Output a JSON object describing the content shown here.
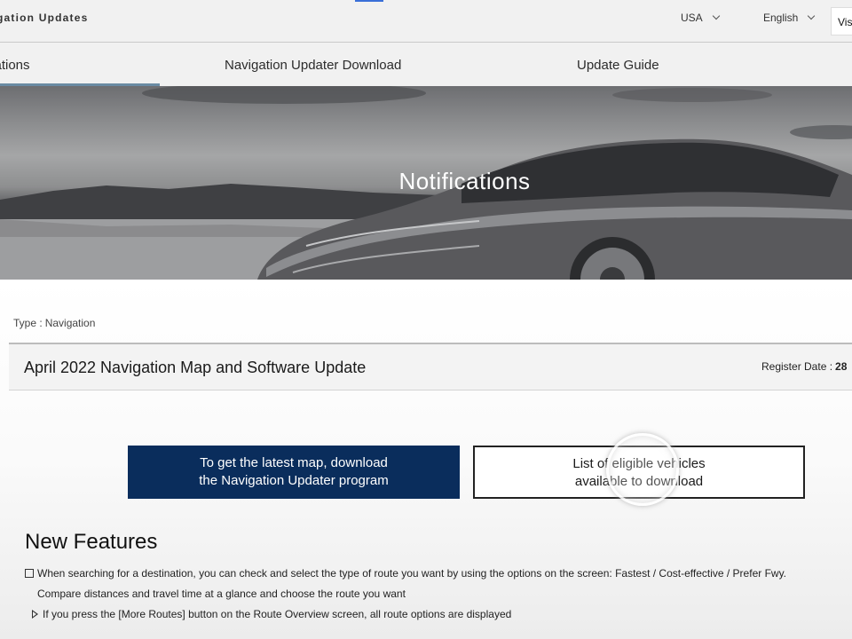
{
  "header": {
    "site_title": "gation Updates",
    "country": "USA",
    "language": "English",
    "visit_label": "Vis"
  },
  "tabs": [
    {
      "label": "cations",
      "active": true
    },
    {
      "label": "Navigation Updater Download",
      "active": false
    },
    {
      "label": "Update Guide",
      "active": false
    }
  ],
  "hero": {
    "title": "Notifications"
  },
  "post": {
    "type_label": "Type :",
    "type_value": "Navigation",
    "title": "April 2022 Navigation Map and Software Update",
    "register_label": "Register Date :",
    "register_value": "28"
  },
  "actions": {
    "download_line1": "To get the latest map, download",
    "download_line2": "the Navigation Updater program",
    "vehicles_line1": "List of eligible vehicles",
    "vehicles_line2": "available to download"
  },
  "features": {
    "heading": "New Features",
    "line1": "When searching for a destination, you can check and select the type of route you want by using the options on the screen: Fastest / Cost-effective / Prefer Fwy.",
    "line2": "Compare distances and travel time at a glance and choose the route you want",
    "line3": "If you press the [More Routes] button on the Route Overview screen, all route options are displayed"
  },
  "colors": {
    "primary_button": "#0a2d5c",
    "tab_underline": "#6a8ba3",
    "top_accent": "#3a6fd8"
  }
}
